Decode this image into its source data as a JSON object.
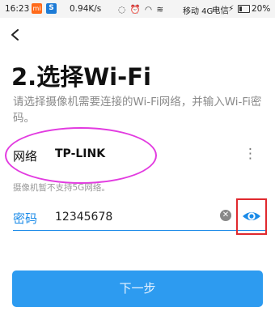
{
  "status_bar": {
    "time": "16:23",
    "speed": "0.94K/s",
    "carrier1": "移动 4G",
    "carrier2": "电信",
    "battery_pct": "20%",
    "mi_icon": "mi-icon",
    "s_icon": "s-icon"
  },
  "page": {
    "title": "2.选择Wi-Fi",
    "description": "请选择摄像机需要连接的Wi-Fi网络，并输入Wi-Fi密码。"
  },
  "network": {
    "label": "网络",
    "value": "TP-LINK"
  },
  "note": "摄像机暂不支持5G网络。",
  "password": {
    "label": "密码",
    "value": "12345678"
  },
  "next_button": "下一步",
  "colors": {
    "accent": "#2d9bf0",
    "highlight_ellipse": "#e23be0",
    "highlight_box": "#e0292e"
  }
}
